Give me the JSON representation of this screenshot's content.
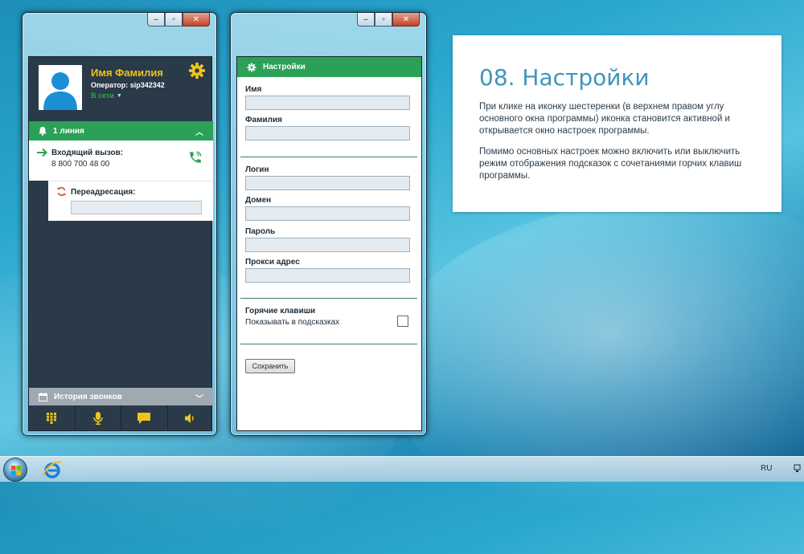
{
  "phone": {
    "user_name": "Имя Фамилия",
    "operator": "Оператор: sip342342",
    "presence": "В сети",
    "line_label": "1 линия",
    "call_title": "Входящий вызов:",
    "call_number": "8 800 700 48 00",
    "redirect_label": "Переадресация:",
    "redirect_value": "",
    "history_label": "История звонков",
    "toolbar": [
      "keypad-icon",
      "microphone-icon",
      "chat-icon",
      "speaker-icon"
    ]
  },
  "settings": {
    "title": "Настройки",
    "fields": {
      "first_name": {
        "label": "Имя",
        "value": ""
      },
      "last_name": {
        "label": "Фамилия",
        "value": ""
      },
      "login": {
        "label": "Логин",
        "value": ""
      },
      "domain": {
        "label": "Домен",
        "value": ""
      },
      "password": {
        "label": "Пароль",
        "value": ""
      },
      "proxy": {
        "label": "Прокси адрес",
        "value": ""
      }
    },
    "hotkeys_title": "Горячие клавиши",
    "hotkeys_hint": "Показывать в подсказках",
    "hotkeys_checked": false,
    "save_label": "Сохранить"
  },
  "info": {
    "title": "08. Настройки",
    "paragraph1": "При клике на иконку шестеренки (в верхнем правом углу основного окна программы) иконка становится активной и открывается окно настроек программы.",
    "paragraph2": "Помимо основных настроек можно включить или выключить режим отображения подсказок с сочетаниями горчих клавиш программы."
  },
  "taskbar": {
    "language": "RU"
  },
  "colors": {
    "accent_green": "#2aa157",
    "gold": "#f0c419",
    "panel_dark": "#2b3a49",
    "title_blue": "#3e96bd"
  }
}
